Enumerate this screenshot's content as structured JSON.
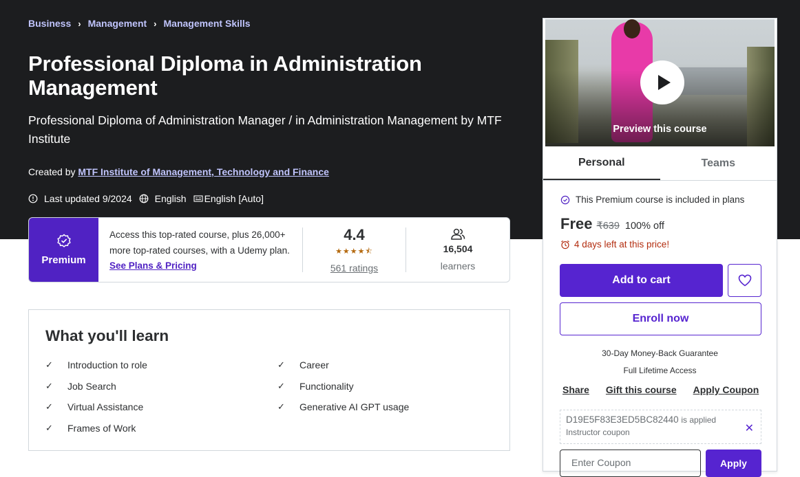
{
  "breadcrumb": [
    "Business",
    "Management",
    "Management Skills"
  ],
  "course": {
    "title": "Professional Diploma in Administration Management",
    "subtitle": "Professional Diploma of Administration Manager / in Administration Management by MTF Institute",
    "created_by_label": "Created by",
    "instructor": "MTF Institute of Management, Technology and Finance",
    "last_updated": "Last updated 9/2024",
    "language": "English",
    "captions": "English [Auto]"
  },
  "premium": {
    "label": "Premium",
    "text": "Access this top-rated course, plus 26,000+ more top-rated courses, with a Udemy plan.",
    "link": "See Plans & Pricing",
    "rating": "4.4",
    "stars": "★★★★⯪",
    "ratings_count": "561 ratings",
    "learners_count": "16,504",
    "learners_label": "learners"
  },
  "learn": {
    "heading": "What you'll learn",
    "col1": [
      "Introduction to role",
      "Job Search",
      "Virtual Assistance",
      "Frames of Work"
    ],
    "col2": [
      "Career",
      "Functionality",
      "Generative AI GPT usage"
    ]
  },
  "sidebar": {
    "preview_label": "Preview this course",
    "tabs": [
      "Personal",
      "Teams"
    ],
    "plan_note": "This Premium course is included in plans",
    "price": "Free",
    "original_price": "₹639",
    "discount": "100% off",
    "urgency": "4 days left at this price!",
    "add_to_cart": "Add to cart",
    "enroll": "Enroll now",
    "guarantee": "30-Day Money-Back Guarantee",
    "lifetime": "Full Lifetime Access",
    "links": [
      "Share",
      "Gift this course",
      "Apply Coupon"
    ],
    "coupon_code": "D19E5F83E3ED5BC82440",
    "coupon_applied": "is applied",
    "coupon_type": "Instructor coupon",
    "coupon_placeholder": "Enter Coupon",
    "apply": "Apply"
  },
  "colors": {
    "brand": "#5624d0",
    "premium": "#5022c3",
    "hero_bg": "#1c1d1f",
    "link_light": "#c0c4fc",
    "urgency": "#b32d0f",
    "star": "#b4690e"
  }
}
